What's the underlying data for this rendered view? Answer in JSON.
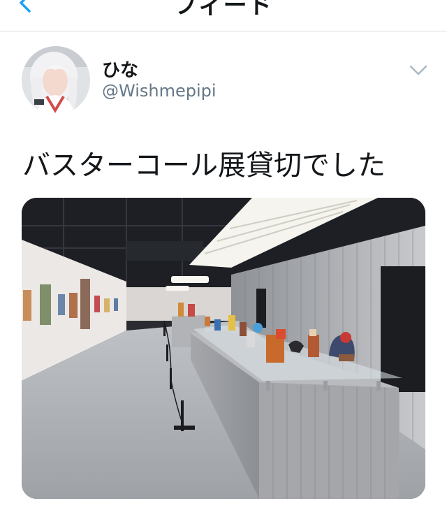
{
  "nav": {
    "title": "フィード",
    "back_icon": "chevron-left-icon"
  },
  "tweet": {
    "display_name": "ひな",
    "handle": "@Wishmepipi",
    "text": "バスターコール展貸切でした",
    "menu_icon": "chevron-down-icon"
  },
  "colors": {
    "accent": "#1da1f2",
    "text_primary": "#14171a",
    "text_secondary": "#657786",
    "divider": "#d9dde1"
  }
}
